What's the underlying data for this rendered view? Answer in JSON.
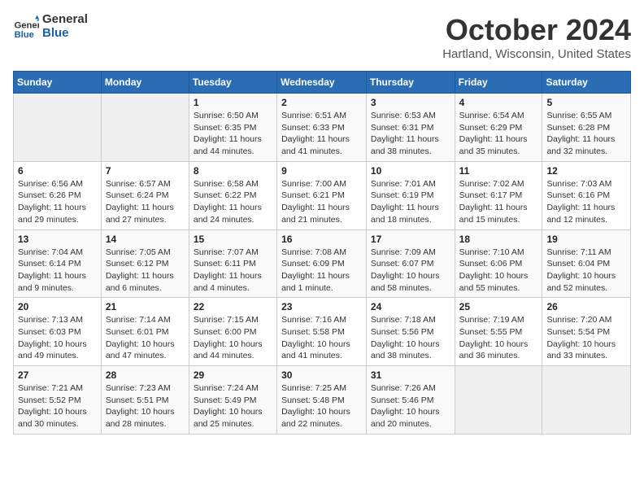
{
  "header": {
    "logo_line1": "General",
    "logo_line2": "Blue",
    "month": "October 2024",
    "location": "Hartland, Wisconsin, United States"
  },
  "columns": [
    "Sunday",
    "Monday",
    "Tuesday",
    "Wednesday",
    "Thursday",
    "Friday",
    "Saturday"
  ],
  "weeks": [
    [
      {
        "num": "",
        "empty": true
      },
      {
        "num": "",
        "empty": true
      },
      {
        "num": "1",
        "sunrise": "6:50 AM",
        "sunset": "6:35 PM",
        "daylight": "11 hours and 44 minutes."
      },
      {
        "num": "2",
        "sunrise": "6:51 AM",
        "sunset": "6:33 PM",
        "daylight": "11 hours and 41 minutes."
      },
      {
        "num": "3",
        "sunrise": "6:53 AM",
        "sunset": "6:31 PM",
        "daylight": "11 hours and 38 minutes."
      },
      {
        "num": "4",
        "sunrise": "6:54 AM",
        "sunset": "6:29 PM",
        "daylight": "11 hours and 35 minutes."
      },
      {
        "num": "5",
        "sunrise": "6:55 AM",
        "sunset": "6:28 PM",
        "daylight": "11 hours and 32 minutes."
      }
    ],
    [
      {
        "num": "6",
        "sunrise": "6:56 AM",
        "sunset": "6:26 PM",
        "daylight": "11 hours and 29 minutes."
      },
      {
        "num": "7",
        "sunrise": "6:57 AM",
        "sunset": "6:24 PM",
        "daylight": "11 hours and 27 minutes."
      },
      {
        "num": "8",
        "sunrise": "6:58 AM",
        "sunset": "6:22 PM",
        "daylight": "11 hours and 24 minutes."
      },
      {
        "num": "9",
        "sunrise": "7:00 AM",
        "sunset": "6:21 PM",
        "daylight": "11 hours and 21 minutes."
      },
      {
        "num": "10",
        "sunrise": "7:01 AM",
        "sunset": "6:19 PM",
        "daylight": "11 hours and 18 minutes."
      },
      {
        "num": "11",
        "sunrise": "7:02 AM",
        "sunset": "6:17 PM",
        "daylight": "11 hours and 15 minutes."
      },
      {
        "num": "12",
        "sunrise": "7:03 AM",
        "sunset": "6:16 PM",
        "daylight": "11 hours and 12 minutes."
      }
    ],
    [
      {
        "num": "13",
        "sunrise": "7:04 AM",
        "sunset": "6:14 PM",
        "daylight": "11 hours and 9 minutes."
      },
      {
        "num": "14",
        "sunrise": "7:05 AM",
        "sunset": "6:12 PM",
        "daylight": "11 hours and 6 minutes."
      },
      {
        "num": "15",
        "sunrise": "7:07 AM",
        "sunset": "6:11 PM",
        "daylight": "11 hours and 4 minutes."
      },
      {
        "num": "16",
        "sunrise": "7:08 AM",
        "sunset": "6:09 PM",
        "daylight": "11 hours and 1 minute."
      },
      {
        "num": "17",
        "sunrise": "7:09 AM",
        "sunset": "6:07 PM",
        "daylight": "10 hours and 58 minutes."
      },
      {
        "num": "18",
        "sunrise": "7:10 AM",
        "sunset": "6:06 PM",
        "daylight": "10 hours and 55 minutes."
      },
      {
        "num": "19",
        "sunrise": "7:11 AM",
        "sunset": "6:04 PM",
        "daylight": "10 hours and 52 minutes."
      }
    ],
    [
      {
        "num": "20",
        "sunrise": "7:13 AM",
        "sunset": "6:03 PM",
        "daylight": "10 hours and 49 minutes."
      },
      {
        "num": "21",
        "sunrise": "7:14 AM",
        "sunset": "6:01 PM",
        "daylight": "10 hours and 47 minutes."
      },
      {
        "num": "22",
        "sunrise": "7:15 AM",
        "sunset": "6:00 PM",
        "daylight": "10 hours and 44 minutes."
      },
      {
        "num": "23",
        "sunrise": "7:16 AM",
        "sunset": "5:58 PM",
        "daylight": "10 hours and 41 minutes."
      },
      {
        "num": "24",
        "sunrise": "7:18 AM",
        "sunset": "5:56 PM",
        "daylight": "10 hours and 38 minutes."
      },
      {
        "num": "25",
        "sunrise": "7:19 AM",
        "sunset": "5:55 PM",
        "daylight": "10 hours and 36 minutes."
      },
      {
        "num": "26",
        "sunrise": "7:20 AM",
        "sunset": "5:54 PM",
        "daylight": "10 hours and 33 minutes."
      }
    ],
    [
      {
        "num": "27",
        "sunrise": "7:21 AM",
        "sunset": "5:52 PM",
        "daylight": "10 hours and 30 minutes."
      },
      {
        "num": "28",
        "sunrise": "7:23 AM",
        "sunset": "5:51 PM",
        "daylight": "10 hours and 28 minutes."
      },
      {
        "num": "29",
        "sunrise": "7:24 AM",
        "sunset": "5:49 PM",
        "daylight": "10 hours and 25 minutes."
      },
      {
        "num": "30",
        "sunrise": "7:25 AM",
        "sunset": "5:48 PM",
        "daylight": "10 hours and 22 minutes."
      },
      {
        "num": "31",
        "sunrise": "7:26 AM",
        "sunset": "5:46 PM",
        "daylight": "10 hours and 20 minutes."
      },
      {
        "num": "",
        "empty": true
      },
      {
        "num": "",
        "empty": true
      }
    ]
  ],
  "labels": {
    "sunrise": "Sunrise:",
    "sunset": "Sunset:",
    "daylight": "Daylight:"
  }
}
